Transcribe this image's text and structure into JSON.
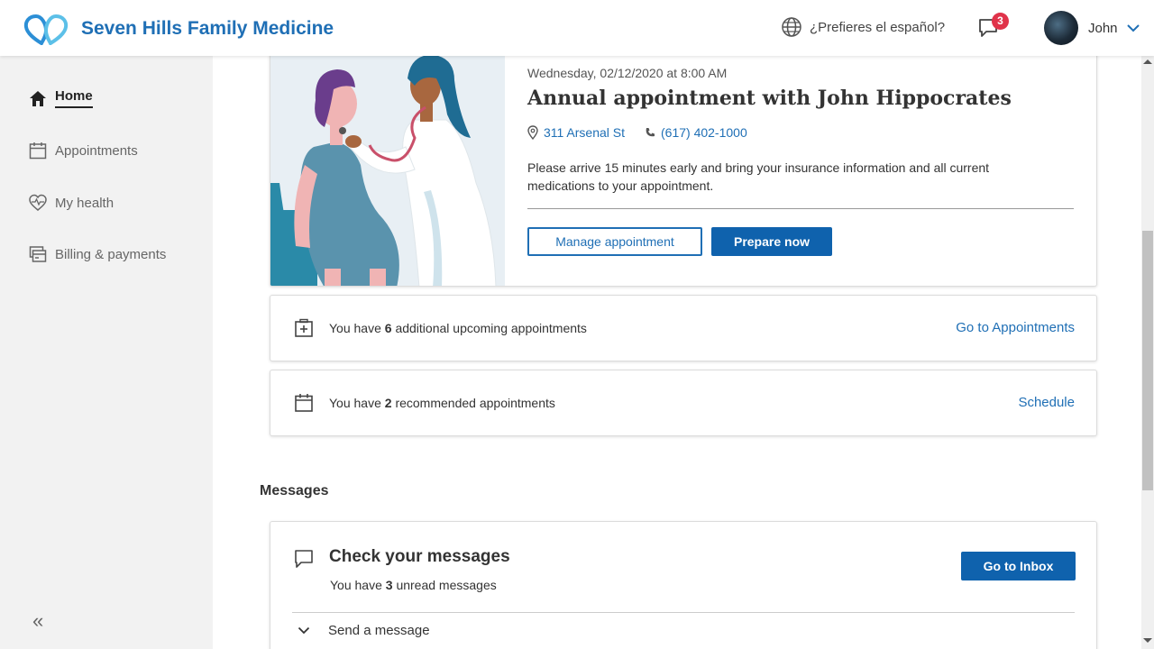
{
  "header": {
    "brand_name": "Seven Hills Family Medicine",
    "language_prompt": "¿Prefieres el español?",
    "notification_count": "3",
    "user_name": "John",
    "brand_color": "#1f6fb5"
  },
  "sidebar": {
    "items": [
      {
        "label": "Home",
        "icon": "home-icon",
        "active": true
      },
      {
        "label": "Appointments",
        "icon": "calendar-icon"
      },
      {
        "label": "My health",
        "icon": "heart-pulse-icon"
      },
      {
        "label": "Billing & payments",
        "icon": "billing-icon"
      }
    ],
    "collapse_label": "«"
  },
  "appointment": {
    "datetime": "Wednesday, 02/12/2020 at 8:00 AM",
    "title": "Annual appointment with John Hippocrates",
    "address": "311 Arsenal St",
    "phone": "(617) 402-1000",
    "note": "Please arrive 15 minutes early and bring your insurance information and all current medications to your appointment.",
    "manage_label": "Manage appointment",
    "prepare_label": "Prepare now"
  },
  "upcoming": {
    "prefix": "You have ",
    "count": "6",
    "suffix": " additional upcoming appointments",
    "link": "Go to Appointments"
  },
  "recommended": {
    "prefix": "You have ",
    "count": "2",
    "suffix": " recommended appointments",
    "link": "Schedule"
  },
  "messages": {
    "section_title": "Messages",
    "title": "Check your messages",
    "sub_prefix": "You have ",
    "unread_count": "3",
    "sub_suffix": " unread messages",
    "inbox_label": "Go to Inbox",
    "send_label": "Send a message"
  }
}
